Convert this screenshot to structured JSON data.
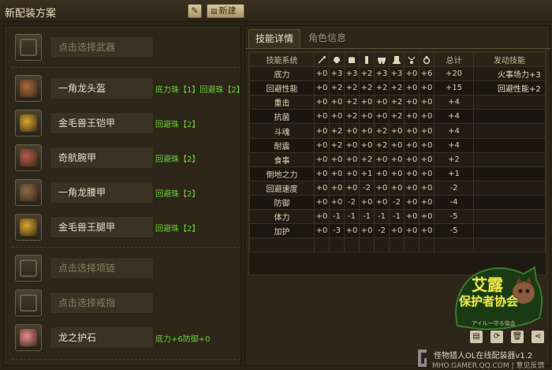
{
  "header": {
    "title": "新配装方案",
    "edit_icon": "pencil-icon",
    "new_label": "新建"
  },
  "slots": [
    {
      "name": "点击选择武器",
      "empty": true,
      "deco": "",
      "icon": "weapon-icon"
    },
    {
      "name": "一角龙头盔",
      "empty": false,
      "deco": "底力珠【1】回避珠【2】",
      "icon": "helmet-icon",
      "color": "#a86a3a"
    },
    {
      "name": "金毛兽王铠甲",
      "empty": false,
      "deco": "回避珠【2】",
      "icon": "chest-armor-icon",
      "color": "#d8a82a"
    },
    {
      "name": "奇航腕甲",
      "empty": false,
      "deco": "回避珠【2】",
      "icon": "gauntlet-icon",
      "color": "#b85a4a"
    },
    {
      "name": "一角龙腰甲",
      "empty": false,
      "deco": "回避珠【2】",
      "icon": "waist-armor-icon",
      "color": "#8a6a4a"
    },
    {
      "name": "金毛兽王腿甲",
      "empty": false,
      "deco": "回避珠【2】",
      "icon": "leg-armor-icon",
      "color": "#d8a82a"
    },
    {
      "name": "点击选择项链",
      "empty": true,
      "deco": "",
      "icon": "necklace-icon"
    },
    {
      "name": "点击选择戒指",
      "empty": true,
      "deco": "",
      "icon": "ring-icon"
    },
    {
      "name": "龙之护石",
      "empty": false,
      "deco": "底力+6防御+0",
      "icon": "talisman-icon",
      "color": "#e88a8a"
    }
  ],
  "tabs": [
    "技能详情",
    "角色信息"
  ],
  "table": {
    "col_skill": "技能系统",
    "col_total": "总计",
    "col_active": "发动技能",
    "icon_cols": [
      "weapon",
      "helmet",
      "chest",
      "arm",
      "waist",
      "leg",
      "necklace",
      "ring"
    ],
    "rows": [
      {
        "name": "底力",
        "v": [
          "+0",
          "+3",
          "+3",
          "+2",
          "+3",
          "+3",
          "+0",
          "+6"
        ],
        "total": "+20",
        "active": "火事场力+3"
      },
      {
        "name": "回避性能",
        "v": [
          "+0",
          "+2",
          "+2",
          "+2",
          "+2",
          "+2",
          "+0",
          "+0"
        ],
        "total": "+15",
        "active": "回避性能+2"
      },
      {
        "name": "重击",
        "v": [
          "+0",
          "+0",
          "+2",
          "+0",
          "+0",
          "+2",
          "+0",
          "+0"
        ],
        "total": "+4",
        "active": ""
      },
      {
        "name": "抗菌",
        "v": [
          "+0",
          "+0",
          "+2",
          "+0",
          "+0",
          "+2",
          "+0",
          "+0"
        ],
        "total": "+4",
        "active": ""
      },
      {
        "name": "斗魂",
        "v": [
          "+0",
          "+2",
          "+0",
          "+0",
          "+2",
          "+0",
          "+0",
          "+0"
        ],
        "total": "+4",
        "active": ""
      },
      {
        "name": "耐震",
        "v": [
          "+0",
          "+2",
          "+0",
          "+0",
          "+2",
          "+0",
          "+0",
          "+0"
        ],
        "total": "+4",
        "active": ""
      },
      {
        "name": "食事",
        "v": [
          "+0",
          "+0",
          "+0",
          "+2",
          "+0",
          "+0",
          "+0",
          "+0"
        ],
        "total": "+2",
        "active": ""
      },
      {
        "name": "倒地之力",
        "v": [
          "+0",
          "+0",
          "+0",
          "+1",
          "+0",
          "+0",
          "+0",
          "+0"
        ],
        "total": "+1",
        "active": ""
      },
      {
        "name": "回避速度",
        "v": [
          "+0",
          "+0",
          "+0",
          "-2",
          "+0",
          "+0",
          "+0",
          "+0"
        ],
        "total": "-2",
        "active": ""
      },
      {
        "name": "防御",
        "v": [
          "+0",
          "+0",
          "-2",
          "+0",
          "+0",
          "-2",
          "+0",
          "+0"
        ],
        "total": "-4",
        "active": ""
      },
      {
        "name": "体力",
        "v": [
          "+0",
          "-1",
          "-1",
          "-1",
          "-1",
          "-1",
          "+0",
          "+0"
        ],
        "total": "-5",
        "active": ""
      },
      {
        "name": "加护",
        "v": [
          "+0",
          "-3",
          "+0",
          "+0",
          "-2",
          "+0",
          "+0",
          "+0"
        ],
        "total": "-5",
        "active": ""
      }
    ],
    "empty_rows": 1
  },
  "logo": {
    "line1": "艾露",
    "line2": "保护者协会",
    "sub": "アイルー守る協会"
  },
  "actions": [
    "save-icon",
    "refresh-icon",
    "delete-icon",
    "share-icon"
  ],
  "footer": {
    "app_name": "怪物猎人OL在线配装器v1.2",
    "site": "MHO.GAMER.QQ.COM",
    "divider": "|",
    "feedback": "意见反馈"
  }
}
